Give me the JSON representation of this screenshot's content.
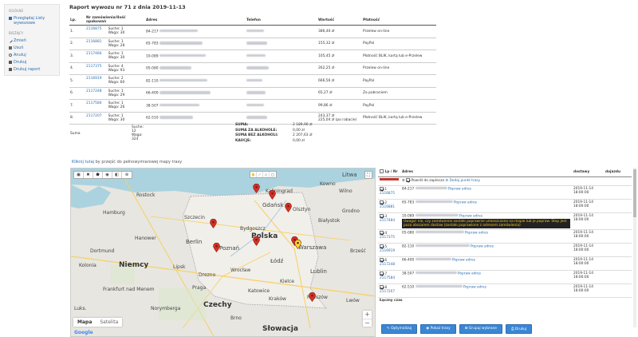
{
  "sidebar": {
    "group1_label": "OGÓLNE",
    "group1_items": [
      {
        "label": "Przeglądaj Listy wywozowe",
        "icon": "list-icon"
      }
    ],
    "group2_label": "BIEŻĄCY",
    "group2_items": [
      {
        "label": "Zmień",
        "icon": "pencil-icon"
      },
      {
        "label": "Usuń",
        "icon": "trash-icon"
      },
      {
        "label": "Anuluj",
        "icon": "cancel-icon"
      },
      {
        "label": "Drukuj",
        "icon": "print-icon"
      },
      {
        "label": "Drukuj raport",
        "icon": "print-icon"
      }
    ]
  },
  "report": {
    "title": "Raport wywozu nr 71 z dnia 2019-11-13",
    "headers": [
      "Lp.",
      "Nr zamówienia/Ilość opakowań",
      "Adres",
      "Telefon",
      "Wartość",
      "Płatność"
    ],
    "rows": [
      {
        "lp": "1.",
        "nr": "2116875",
        "qty": "Suche: 1\nWaga: 30",
        "zip": "84-217",
        "value": "386,40 zł",
        "pay": "Przelew on-line"
      },
      {
        "lp": "2.",
        "nr": "2116881",
        "qty": "Suche: 1\nWaga: 28",
        "zip": "65-783",
        "value": "155,32 zł",
        "pay": "PayPal"
      },
      {
        "lp": "3.",
        "nr": "2117484",
        "qty": "Suche: 1\nWaga: 30",
        "zip": "10-089",
        "value": "105,45 zł",
        "pay": "Płatność BLIK, kartą lub e-Przelew"
      },
      {
        "lp": "4.",
        "nr": "2117375",
        "qty": "Suche: 4\nWaga: 93",
        "zip": "05-080",
        "value": "262,25 zł",
        "pay": "Przelew on-line"
      },
      {
        "lp": "5.",
        "nr": "2116919",
        "qty": "Suche: 2\nWaga: 60",
        "zip": "82-110",
        "value": "666,56 zł",
        "pay": "PayPal"
      },
      {
        "lp": "6.",
        "nr": "2117248",
        "qty": "Suche: 1\nWaga: 29",
        "zip": "66-400",
        "value": "65,27 zł",
        "pay": "Za pobraniem"
      },
      {
        "lp": "7.",
        "nr": "2117584",
        "qty": "Suche: 1\nWaga: 26",
        "zip": "38-507",
        "value": "99,86 zł",
        "pay": "PayPal"
      },
      {
        "lp": "8.",
        "nr": "2117207",
        "qty": "Suche: 1\nWaga: 30",
        "zip": "62-510",
        "value": "243,37 zł\n225,04 zł (po rabacie)",
        "pay": "Płatność BLIK, kartą lub e-Przelew"
      }
    ],
    "total_label": "Suma",
    "total_qty": "Suche: 12\nWaga: 324"
  },
  "sums": [
    {
      "label": "SUMA:",
      "value": "2 189,90 zł"
    },
    {
      "label": "SUMA ZA ALKOHOLE:",
      "value": "0,00 zł"
    },
    {
      "label": "SUMA BEZ ALKOHOLI:",
      "value": "2 207,63 zł"
    },
    {
      "label": "KAUCJE:",
      "value": "0,00 zł"
    }
  ],
  "map_link": {
    "link": "Kliknij tutaj",
    "rest": " by przejść do pełnowymiarowej mapy trasy"
  },
  "map": {
    "type_map": "Mapa",
    "type_sat": "Satelita",
    "google": "Google",
    "labels": {
      "litwa": "Litwa",
      "gdansk": "Gdańsk",
      "polska": "Polska",
      "warszawa": "Warszawa",
      "niemcy": "Niemcy",
      "poznan": "Poznań",
      "lodz": "Łódź",
      "lublin": "Lublin",
      "berlin": "Berlin",
      "bydgoszcz": "Bydgoszcz",
      "czechy": "Czechy",
      "krakow": "Kraków",
      "praga": "Praga",
      "slowacja": "Słowacja",
      "hamburg": "Hamburg",
      "rostock": "Rostock",
      "szczecin": "Szczecin",
      "olsztyn": "Olsztyn",
      "bialystok": "Białystok",
      "wroclaw": "Wrocław",
      "katowice": "Katowice",
      "lipsk": "Lipsk",
      "drezno": "Drezno",
      "hanower": "Hanower",
      "frankfurt": "Frankfurt nad Menem",
      "norymberga": "Norymberga",
      "brno": "Brno",
      "grodno": "Grodno",
      "brzesc": "Brześć",
      "kowno": "Kowno",
      "wilno": "Wilno",
      "rzeszow": "Rzeszów",
      "kaliningrad": "Kaliningrad",
      "kielce": "Kielce",
      "luxem": "Luks.",
      "kolonia": "Kolonia",
      "dortmund": "Dortmund",
      "lwow": "Lwów"
    }
  },
  "stops": {
    "headers": [
      "Lp / Nr",
      "Adres",
      "dostawy",
      "dojazdu"
    ],
    "return_label": "Powrót do zaplecza",
    "add_point": "Dodaj punkt trasy",
    "fix": "Popraw adres",
    "rows": [
      {
        "lp": "1",
        "nr": "2116875",
        "zip": "84-217",
        "date": "2019-11-14",
        "time": "18:00:00"
      },
      {
        "lp": "2",
        "nr": "2116881",
        "zip": "65-783",
        "date": "2019-11-14",
        "time": "18:00:00"
      },
      {
        "lp": "3",
        "nr": "2117484",
        "zip": "10-089",
        "date": "2019-11-14",
        "time": "18:00:00",
        "warn": "Uwaga! nie, czy zamówienie zostało poprawnie umieszczone na mapie lub je popraw. Stop jest poza obszarem dostaw (zostało poprawione z adresem zamówienia)"
      },
      {
        "lp": "4",
        "nr": "2117375",
        "zip": "05-080",
        "date": "2019-11-14",
        "time": "18:00:00"
      },
      {
        "lp": "5",
        "nr": "2116919",
        "zip": "82-110",
        "date": "2019-11-14",
        "time": "18:00:00"
      },
      {
        "lp": "6",
        "nr": "2117248",
        "zip": "66-400",
        "date": "2019-11-14",
        "time": "18:00:00"
      },
      {
        "lp": "7",
        "nr": "2117584",
        "zip": "38-507",
        "date": "2019-11-14",
        "time": "18:00:00"
      },
      {
        "lp": "8",
        "nr": "2117207",
        "zip": "62-510",
        "date": "2019-11-14",
        "time": "18:00:00"
      }
    ],
    "total_label": "Łączny czas"
  },
  "buttons": {
    "optimize": "Optymalizuj",
    "show": "Pokaż trasy",
    "group": "Grupuj wybrane",
    "print": "Drukuj"
  },
  "colors": {
    "link": "#2a6db0",
    "button": "#3a86d4",
    "pin": "#d93025",
    "pin_selected": "#f5e023"
  }
}
